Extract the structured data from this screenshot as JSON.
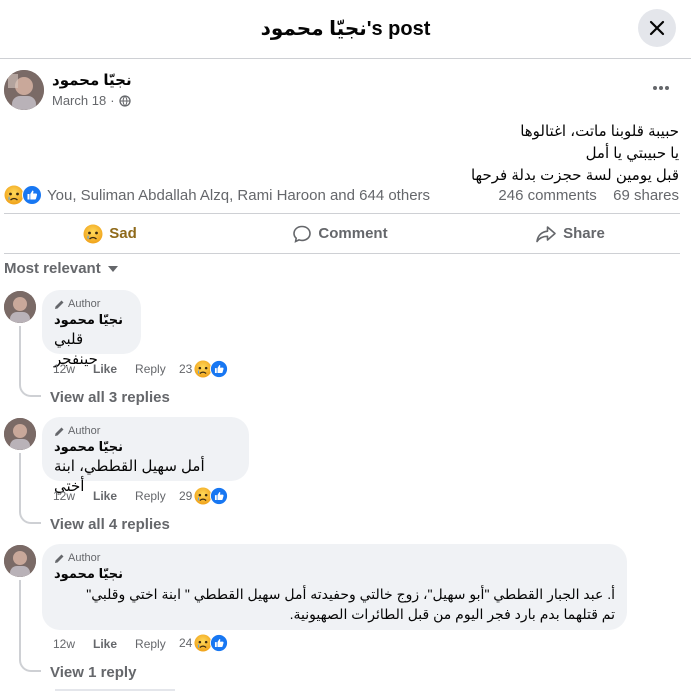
{
  "header": {
    "title": "نجيّا محمود's post",
    "close_icon": "close-icon"
  },
  "post": {
    "author": "نجيّا محمود",
    "date": "March 18",
    "privacy_icon": "globe-icon",
    "lines": [
      "حبيبة قلوبنا ماتت، اغتالوها",
      "يا حبيبتي يا أمل",
      "قبل يومين لسة حجزت بدلة فرحها"
    ],
    "reactions_text": "You, Suliman Abdallah Alzq, Rami Haroon and 644 others",
    "comments_count": "246 comments",
    "shares_count": "69 shares"
  },
  "actions": {
    "sad": "Sad",
    "comment": "Comment",
    "share": "Share"
  },
  "sort_label": "Most relevant",
  "comments": [
    {
      "tag": "Author",
      "name": "نجيّا محمود",
      "text": "قلبي حينفجر",
      "time": "12w",
      "like": "Like",
      "reply": "Reply",
      "reactions": "23",
      "view_replies": "View all 3 replies"
    },
    {
      "tag": "Author",
      "name": "نجيّا محمود",
      "text": "أمل سهيل القططي، ابنة أختي",
      "time": "12w",
      "like": "Like",
      "reply": "Reply",
      "reactions": "29",
      "view_replies": "View all 4 replies"
    },
    {
      "tag": "Author",
      "name": "نجيّا محمود",
      "text_lines": [
        "أ. عبد الجبار القططي \"أبو سهيل\"، زوج خالتي وحفيدته أمل سهيل القططي \" ابنة اختي وقلبي\"",
        "تم قتلهما بدم بارد فجر اليوم من قبل الطائرات الصهيونية."
      ],
      "time": "12w",
      "like": "Like",
      "reply": "Reply",
      "reactions": "24",
      "view_replies": "View 1 reply"
    }
  ],
  "colors": {
    "accent": "#1877f2",
    "sad": "#f7b125",
    "text_secondary": "#65676b",
    "bubble": "#f0f2f5"
  }
}
